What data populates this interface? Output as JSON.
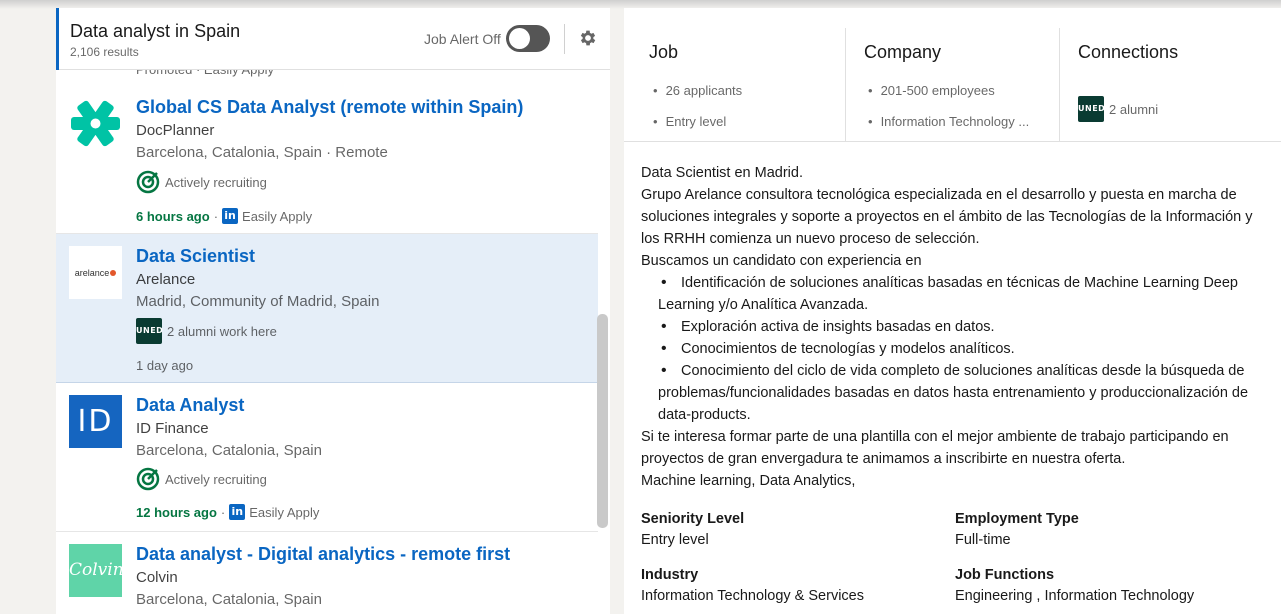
{
  "search": {
    "title": "Data analyst in Spain",
    "results": "2,106 results",
    "job_alert_label": "Job Alert Off",
    "job_alert_on": false
  },
  "peek": {
    "text": "Promoted · Easily Apply"
  },
  "jobs": [
    {
      "title": "Global CS Data Analyst (remote within Spain)",
      "company": "DocPlanner",
      "location": "Barcelona, Catalonia, Spain · Remote",
      "insight": "Actively recruiting",
      "time": "6 hours ago",
      "apply": "Easily Apply",
      "logo_text": ""
    },
    {
      "title": "Data Scientist",
      "company": "Arelance",
      "location": "Madrid, Community of Madrid, Spain",
      "insight": "2 alumni work here",
      "time": "1 day ago",
      "logo_text": "arelance"
    },
    {
      "title": "Data Analyst",
      "company": "ID Finance",
      "location": "Barcelona, Catalonia, Spain",
      "insight": "Actively recruiting",
      "time": "12 hours ago",
      "apply": "Easily Apply",
      "logo_text": "ID"
    },
    {
      "title": "Data analyst - Digital analytics - remote first",
      "company": "Colvin",
      "location": "Barcelona, Catalonia, Spain",
      "logo_text": "Colvin"
    }
  ],
  "uned_text": "UNED",
  "in_text": "in",
  "insights": {
    "job": {
      "heading": "Job",
      "items": [
        "26 applicants",
        "Entry level"
      ]
    },
    "company": {
      "heading": "Company",
      "items": [
        "201-500 employees",
        "Information Technology ..."
      ]
    },
    "connections": {
      "heading": "Connections",
      "alumni": "2 alumni"
    }
  },
  "description": {
    "intro": [
      "Data Scientist en Madrid.",
      "Grupo Arelance consultora tecnológica especializada en el desarrollo y puesta en marcha de soluciones integrales y soporte a proyectos en el ámbito de las Tecnologías de la Información y los RRHH comienza un nuevo proceso de selección.",
      "Buscamos un candidato con experiencia en"
    ],
    "bullets": [
      "Identificación de soluciones analíticas basadas en técnicas de Machine Learning Deep Learning y/o Analítica Avanzada.",
      "Exploración activa de insights basadas en datos.",
      "Conocimientos de tecnologías y modelos analíticos.",
      "Conocimiento del ciclo de vida completo de soluciones analíticas desde la búsqueda de problemas/funcionalidades basadas en datos hasta entrenamiento y produccionalización de data-products."
    ],
    "outro": [
      "Si te interesa formar parte de una plantilla con el mejor ambiente de trabajo participando en proyectos de gran envergadura te animamos a inscribirte en nuestra oferta.",
      "Machine learning, Data Analytics,"
    ]
  },
  "criteria": {
    "seniority_label": "Seniority Level",
    "seniority_value": "Entry level",
    "employment_label": "Employment Type",
    "employment_value": "Full-time",
    "industry_label": "Industry",
    "industry_value": "Information Technology & Services",
    "functions_label": "Job Functions",
    "functions_value": "Engineering , Information Technology"
  },
  "colors": {
    "accent": "#0a66c2",
    "recruiting_green": "#057642",
    "selected_bg": "#e5eef8",
    "docplanner_teal": "#00c3a5",
    "uned_green": "#0a3b32"
  }
}
